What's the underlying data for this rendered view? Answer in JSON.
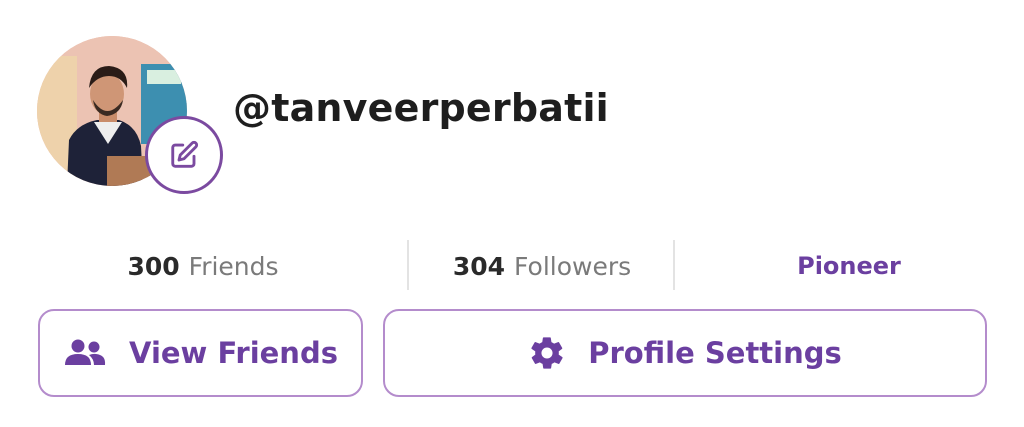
{
  "profile": {
    "username": "@tanveerperbatii",
    "avatar_icon": "profile-photo",
    "edit_icon": "edit-icon"
  },
  "stats": {
    "friends_count": "300",
    "friends_label": "Friends",
    "followers_count": "304",
    "followers_label": "Followers",
    "rank": "Pioneer"
  },
  "actions": {
    "view_friends_label": "View Friends",
    "view_friends_icon": "people-icon",
    "profile_settings_label": "Profile Settings",
    "profile_settings_icon": "gear-icon"
  },
  "colors": {
    "accent": "#6b3fa0",
    "button_border": "#b48ccc",
    "divider": "#e3e3e3"
  }
}
